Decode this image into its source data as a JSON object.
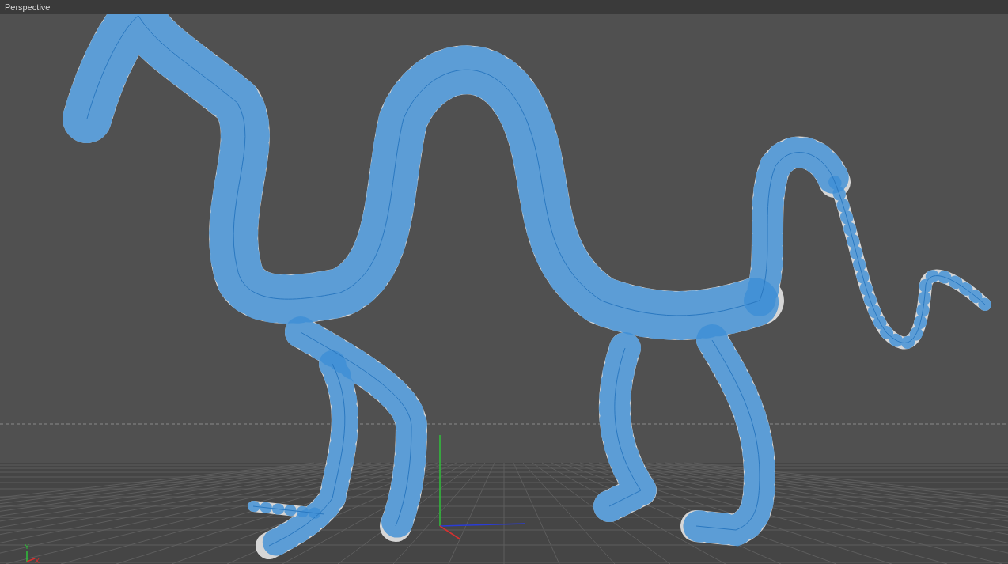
{
  "viewport": {
    "title": "Perspective"
  },
  "axis_gizmo": {
    "labels": [
      "Y",
      "X"
    ]
  }
}
